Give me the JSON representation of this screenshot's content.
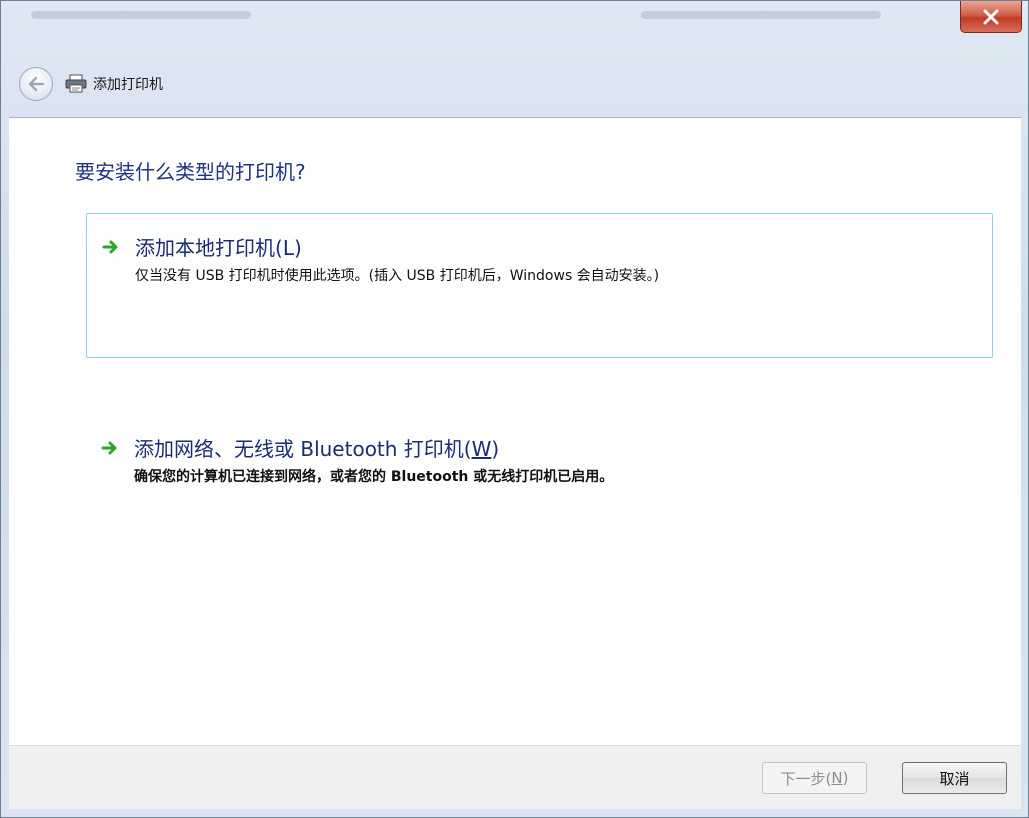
{
  "window": {
    "close_glyph": "x"
  },
  "nav": {
    "back_icon": "back-arrow-icon",
    "title_icon": "printer-icon",
    "title": "添加打印机"
  },
  "main": {
    "heading": "要安装什么类型的打印机?",
    "options": [
      {
        "icon": "green-arrow-icon",
        "title_prefix": "添加本地打印机(",
        "title_accel": "L",
        "title_suffix": ")",
        "description": "仅当没有 USB 打印机时使用此选项。(插入 USB 打印机后，Windows 会自动安装。)"
      },
      {
        "icon": "green-arrow-icon",
        "title_prefix": "添加网络、无线或 Bluetooth 打印机(",
        "title_accel": "W",
        "title_suffix": ")",
        "description": "确保您的计算机已连接到网络，或者您的 Bluetooth 或无线打印机已启用。"
      }
    ]
  },
  "footer": {
    "next_prefix": "下一步(",
    "next_accel": "N",
    "next_suffix": ")",
    "cancel": "取消"
  },
  "colors": {
    "heading": "#1e3287",
    "option_title": "#1a2c74",
    "option_border": "#8ed3ee",
    "arrow": "#2ea62e",
    "close_button": "#c8412c"
  }
}
